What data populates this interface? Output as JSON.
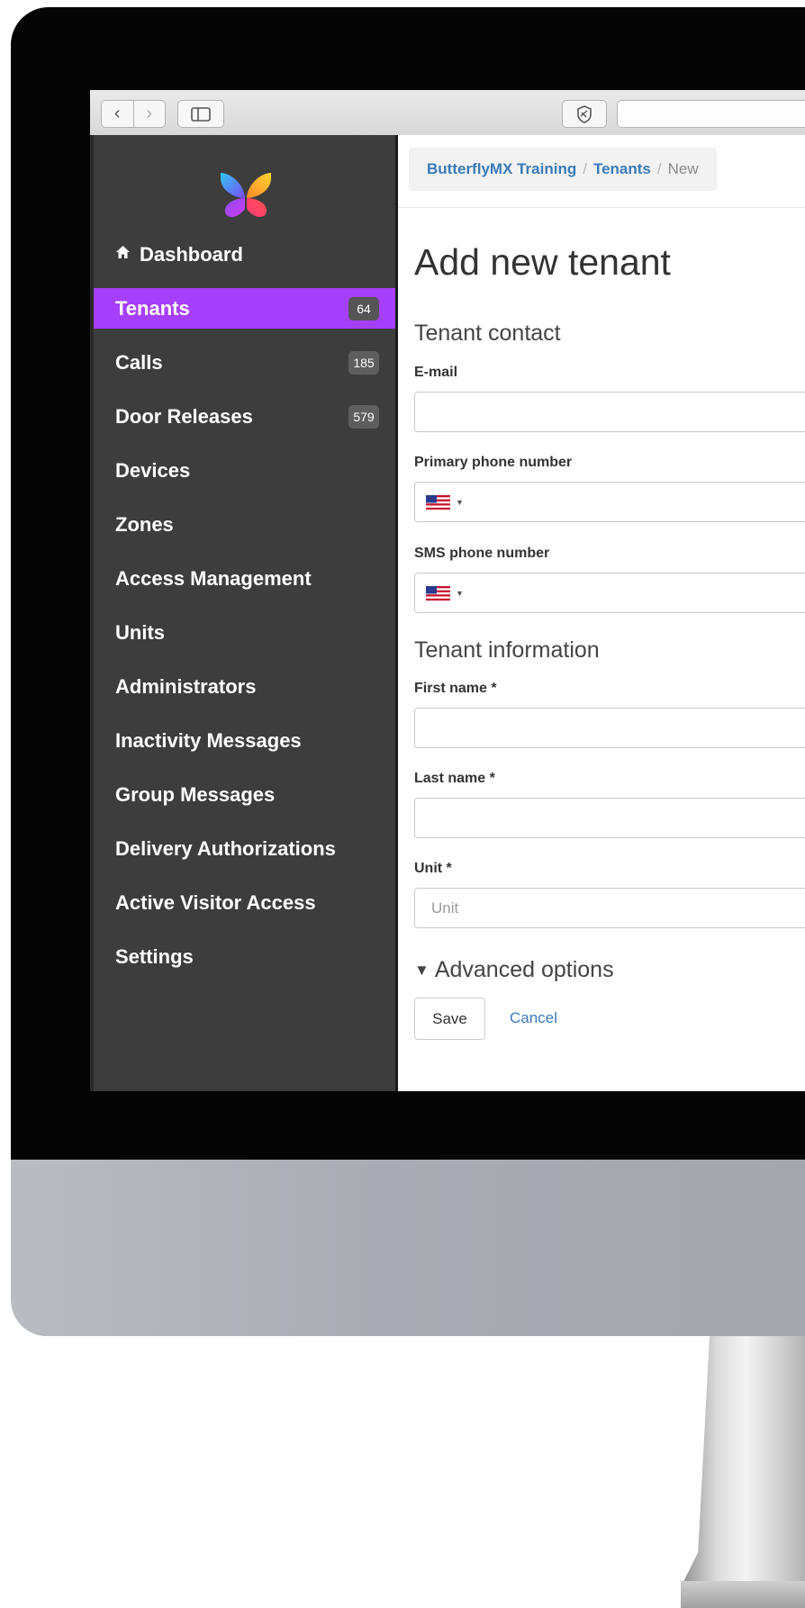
{
  "browser": {
    "back_glyph": "‹",
    "forward_glyph": "›"
  },
  "app": {
    "logo_icon": "butterfly-logo-icon",
    "accent_color": "#a63ffc"
  },
  "sidebar": {
    "items": [
      {
        "label": "Dashboard",
        "icon": "home-icon",
        "active": false,
        "badge": ""
      },
      {
        "label": "Tenants",
        "active": true,
        "badge": "64"
      },
      {
        "label": "Calls",
        "active": false,
        "badge": "185"
      },
      {
        "label": "Door Releases",
        "active": false,
        "badge": "579"
      },
      {
        "label": "Devices",
        "active": false,
        "badge": ""
      },
      {
        "label": "Zones",
        "active": false,
        "badge": ""
      },
      {
        "label": "Access Management",
        "active": false,
        "badge": ""
      },
      {
        "label": "Units",
        "active": false,
        "badge": ""
      },
      {
        "label": "Administrators",
        "active": false,
        "badge": ""
      },
      {
        "label": "Inactivity Messages",
        "active": false,
        "badge": ""
      },
      {
        "label": "Group Messages",
        "active": false,
        "badge": ""
      },
      {
        "label": "Delivery Authorizations",
        "active": false,
        "badge": ""
      },
      {
        "label": "Active Visitor Access",
        "active": false,
        "badge": ""
      },
      {
        "label": "Settings",
        "active": false,
        "badge": ""
      }
    ]
  },
  "breadcrumb": {
    "items": [
      "ButterflyMX Training",
      "Tenants",
      "New"
    ],
    "separator": "/"
  },
  "form": {
    "title": "Add new tenant",
    "contact_section": "Tenant contact",
    "email_label": "E-mail",
    "email_value": "",
    "primary_phone_label": "Primary phone number",
    "sms_phone_label": "SMS phone number",
    "phone_country_icon": "us-flag-icon",
    "info_section": "Tenant information",
    "first_name_label": "First name *",
    "first_name_value": "",
    "last_name_label": "Last name *",
    "last_name_value": "",
    "unit_label": "Unit *",
    "unit_placeholder": "Unit",
    "advanced_label": "Advanced options",
    "save_label": "Save",
    "cancel_label": "Cancel"
  }
}
